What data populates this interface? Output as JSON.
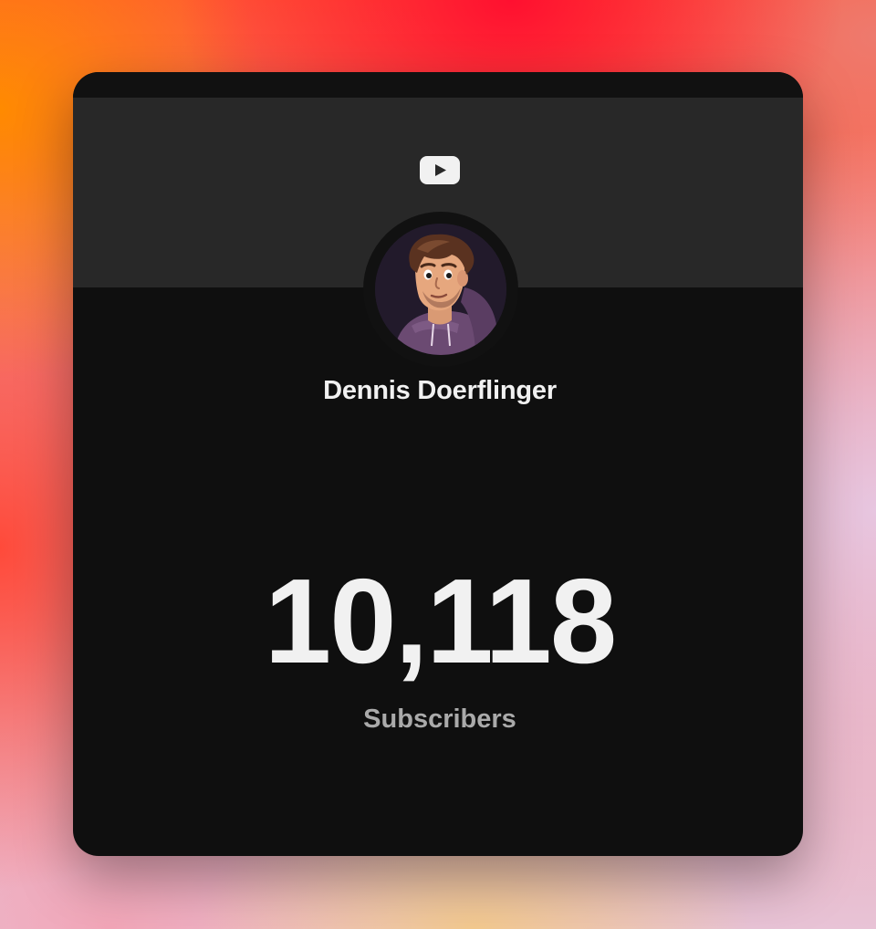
{
  "widget": {
    "platform_icon": "youtube-play-icon",
    "channel_name": "Dennis Doerflinger",
    "subscriber_count": "10,118",
    "subscriber_label": "Subscribers",
    "avatar": "cartoon-avatar-man-in-purple-hoodie"
  },
  "colors": {
    "card_background": "#0f0f0f",
    "banner_background": "#282828",
    "text_primary": "#f1f1f1",
    "text_secondary": "#aaaaaa",
    "icon": "#f1f1f1"
  }
}
